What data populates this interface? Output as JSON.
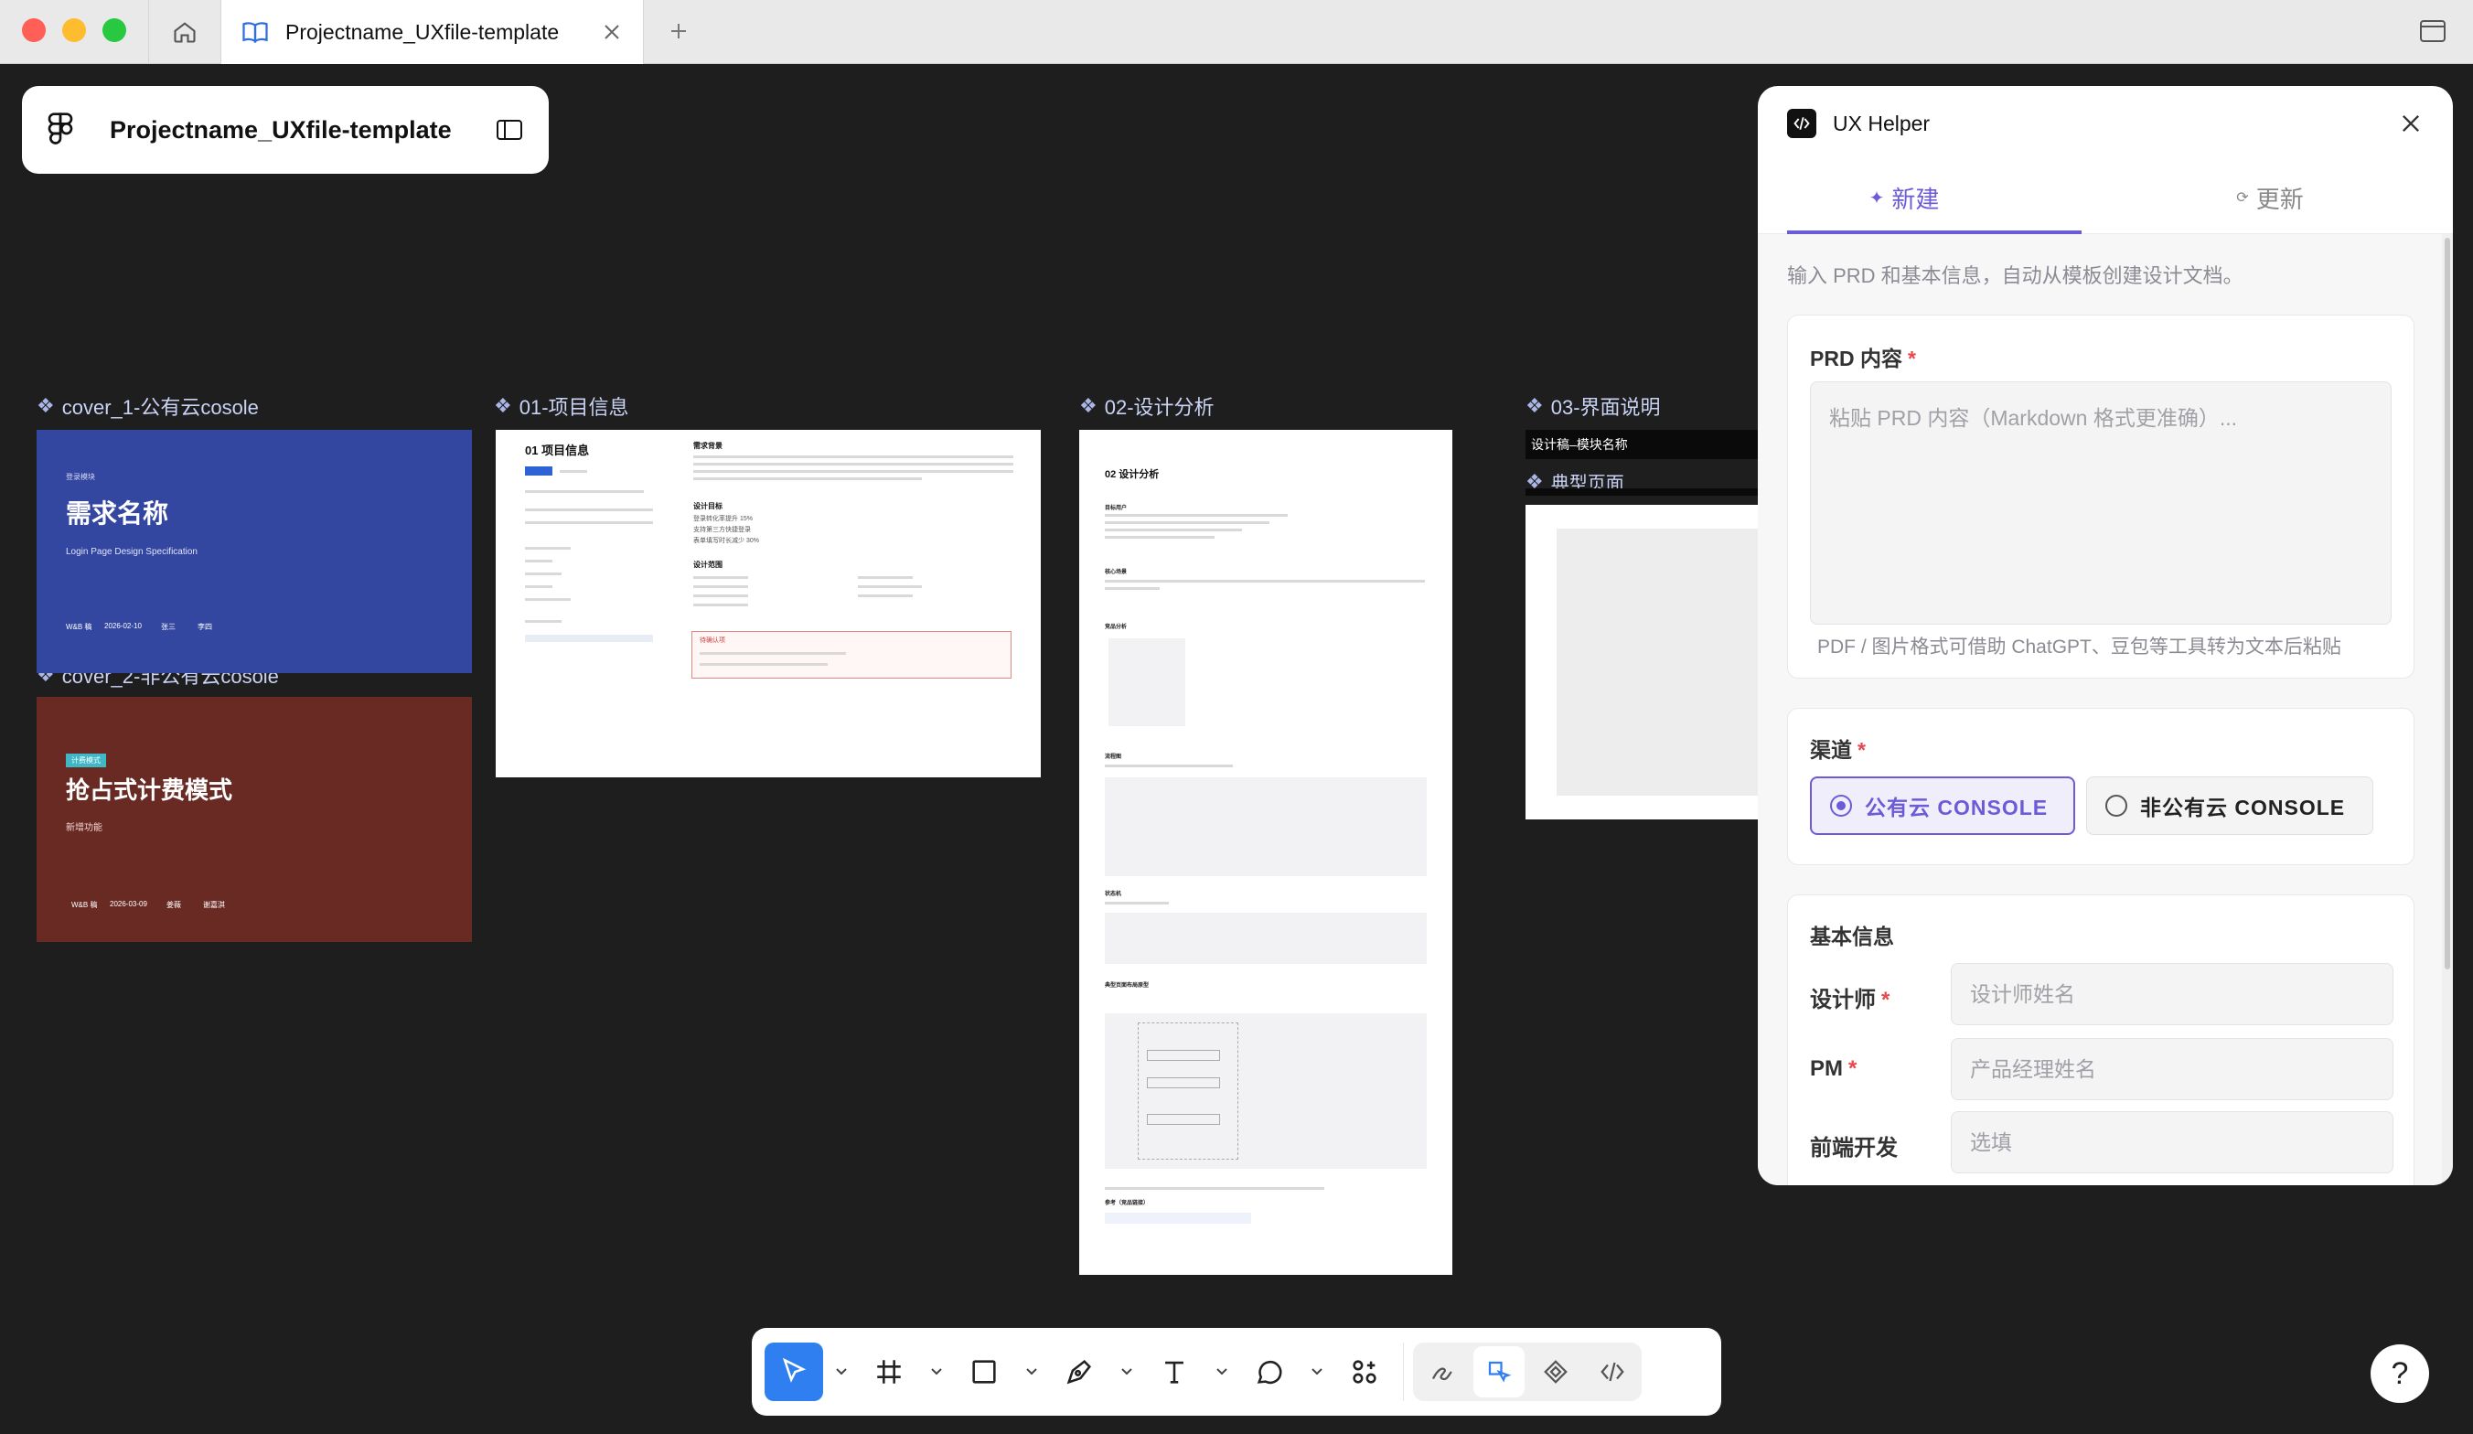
{
  "window": {
    "tab_title": "Projectname_UXfile-template"
  },
  "project": {
    "name": "Projectname_UXfile-template"
  },
  "frames": {
    "cover1_label": "cover_1-公有云cosole",
    "cover2_label": "cover_2-非公有云cosole",
    "info_label": "01-项目信息",
    "analysis_label": "02-设计分析",
    "ui_label": "03-界面说明",
    "ui_sub_label": "设计稿–模块名称",
    "typical_label": "典型页面"
  },
  "cover1": {
    "tag": "登录模块",
    "title": "需求名称",
    "subtitle": "Login Page Design Specification",
    "meta": [
      "W&B 稿",
      "2026-02-10",
      "张三",
      "李四"
    ],
    "bg": "#3346a0"
  },
  "cover2": {
    "tag": "计费模式",
    "title": "抢占式计费模式",
    "subtitle": "新增功能",
    "meta": [
      "W&B 稿",
      "2026-03-09",
      "姜薇",
      "谢嘉淇"
    ],
    "bg": "#6a2a24"
  },
  "info_frame": {
    "heading": "01 项目信息",
    "col2_title": "需求背景",
    "goal_title": "设计目标",
    "goals": [
      "登录转化率提升 15%",
      "支持第三方快捷登录",
      "表单填写时长减少 30%"
    ],
    "scope_title": "设计范围",
    "note_title": "待确认项"
  },
  "analysis_frame": {
    "heading": "02 设计分析",
    "sections": [
      "目标用户",
      "核心场景",
      "竞品分析",
      "流程图",
      "状态机",
      "典型页面布局原型",
      "参考（竞品链接）"
    ]
  },
  "ux_helper": {
    "title": "UX Helper",
    "tab_new": "新建",
    "tab_update": "更新",
    "intro": "输入 PRD 和基本信息，自动从模板创建设计文档。",
    "prd_label": "PRD 内容",
    "prd_placeholder": "粘贴 PRD 内容（Markdown 格式更准确）...",
    "prd_hint": "PDF / 图片格式可借助 ChatGPT、豆包等工具转为文本后粘贴",
    "channel_label": "渠道",
    "channel_public": "公有云 CONSOLE",
    "channel_private": "非公有云 CONSOLE",
    "basic_label": "基本信息",
    "designer_label": "设计师",
    "designer_placeholder": "设计师姓名",
    "pm_label": "PM",
    "pm_placeholder": "产品经理姓名",
    "fe_label": "前端开发",
    "fe_placeholder": "选填",
    "accent": "#6b5bd6"
  },
  "toolbar": {
    "tools": [
      "move-tool",
      "frame-tool",
      "shape-tool",
      "pen-tool",
      "text-tool",
      "comment-tool",
      "actions-tool",
      "draw-mode",
      "design-mode",
      "dev-mode",
      "code-mode"
    ]
  },
  "help": {
    "label": "?"
  }
}
